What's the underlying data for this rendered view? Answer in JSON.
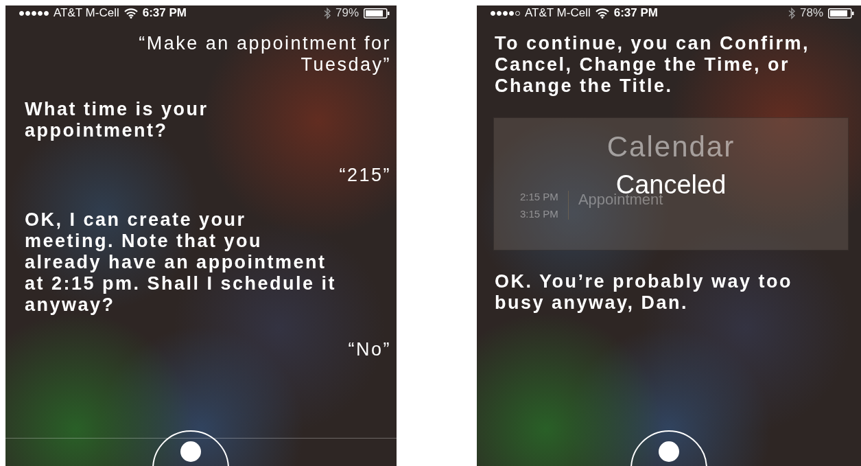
{
  "phones": [
    {
      "status_bar": {
        "signal": [
          {
            "filled": true
          },
          {
            "filled": true
          },
          {
            "filled": true
          },
          {
            "filled": true
          },
          {
            "filled": true
          }
        ],
        "carrier": "AT&T M-Cell",
        "time": "6:37 PM",
        "battery": "79%"
      },
      "messages": [
        {
          "kind": "user",
          "text": "“Make an appointment for\nTuesday”"
        },
        {
          "kind": "siri",
          "text": "What time is your\nappointment?"
        },
        {
          "kind": "user",
          "text": "“215”"
        },
        {
          "kind": "siri",
          "text": "OK, I can create your\nmeeting. Note that you\nalready have an appointment\nat 2:15 pm. Shall I schedule it\nanyway?"
        },
        {
          "kind": "user",
          "text": "“No”"
        }
      ],
      "divider": true
    },
    {
      "status_bar": {
        "signal": [
          {
            "filled": true
          },
          {
            "filled": true
          },
          {
            "filled": true
          },
          {
            "filled": true
          },
          {
            "filled": false
          }
        ],
        "carrier": "AT&T M-Cell",
        "time": "6:37 PM",
        "battery": "78%"
      },
      "messages": [
        {
          "kind": "siri",
          "text": "To continue, you can Confirm,\nCancel, Change the Time, or\nChange the Title."
        },
        {
          "kind": "card",
          "title": "Calendar",
          "overlay": "Canceled",
          "start": "2:15 PM",
          "end": "3:15 PM",
          "event": "Appointment"
        },
        {
          "kind": "siri",
          "text": "OK. You’re probably way too\nbusy anyway, Dan."
        }
      ],
      "divider": false
    }
  ]
}
